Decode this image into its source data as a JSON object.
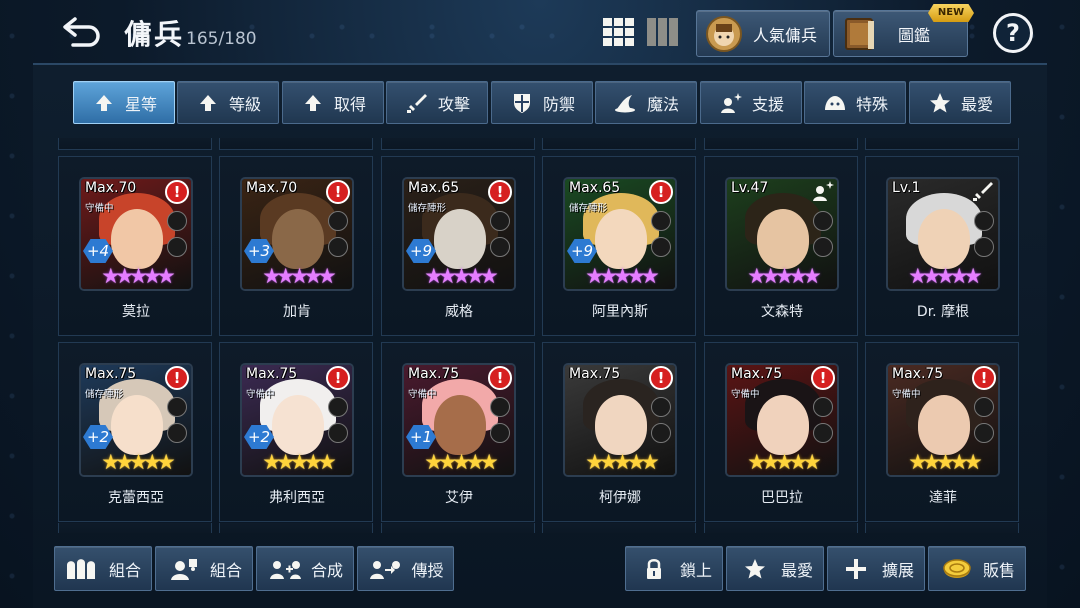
{
  "header": {
    "title": "傭兵",
    "count": "165/180",
    "popular_label": "人氣傭兵",
    "codex_label": "圖鑑",
    "new_badge": "NEW",
    "help_label": "?"
  },
  "filters": [
    {
      "label": "星等",
      "icon": "arrow-up-icon",
      "active": true
    },
    {
      "label": "等級",
      "icon": "arrow-up-icon",
      "active": false
    },
    {
      "label": "取得",
      "icon": "arrow-up-icon",
      "active": false
    },
    {
      "label": "攻擊",
      "icon": "sword-icon",
      "active": false
    },
    {
      "label": "防禦",
      "icon": "shield-icon",
      "active": false
    },
    {
      "label": "魔法",
      "icon": "wizard-hat-icon",
      "active": false
    },
    {
      "label": "支援",
      "icon": "sparkle-person-icon",
      "active": false
    },
    {
      "label": "特殊",
      "icon": "slime-icon",
      "active": false
    },
    {
      "label": "最愛",
      "icon": "star-icon",
      "active": false
    }
  ],
  "mercenaries": [
    {
      "name": "莫拉",
      "level": "Max.70",
      "status": "守備中",
      "plus": "+4",
      "star_color": "purple",
      "alert": true,
      "bg": "#6e1a1a",
      "hair": "#c8442a",
      "skin": "#f1c7a6"
    },
    {
      "name": "加肯",
      "level": "Max.70",
      "status": "",
      "plus": "+3",
      "star_color": "purple",
      "alert": true,
      "bg": "#3a2414",
      "hair": "#5a3a22",
      "skin": "#8a6848"
    },
    {
      "name": "威格",
      "level": "Max.65",
      "status": "儲存陣形",
      "plus": "+9",
      "star_color": "purple",
      "alert": true,
      "bg": "#2a2018",
      "hair": "#3b2a1c",
      "skin": "#d8d2c8"
    },
    {
      "name": "阿里內斯",
      "level": "Max.65",
      "status": "儲存陣形",
      "plus": "+9",
      "star_color": "purple",
      "alert": true,
      "bg": "#1a4a22",
      "hair": "#e0b85a",
      "skin": "#f3d8bd"
    },
    {
      "name": "文森特",
      "level": "Lv.47",
      "status": "",
      "plus": "",
      "star_color": "purple",
      "alert": false,
      "bg": "#1d3f1d",
      "hair": "#2c2418",
      "skin": "#e6c4a2"
    },
    {
      "name": "Dr. 摩根",
      "level": "Lv.1",
      "status": "",
      "plus": "",
      "star_color": "purple",
      "alert": false,
      "bg": "#2a2a2a",
      "hair": "#d8d8d8",
      "skin": "#efd2b6"
    },
    {
      "name": "克蕾西亞",
      "level": "Max.75",
      "status": "儲存陣形",
      "plus": "+2",
      "star_color": "gold",
      "alert": true,
      "bg": "#1e3a5a",
      "hair": "#d6c8b8",
      "skin": "#f6dfcb"
    },
    {
      "name": "弗利西亞",
      "level": "Max.75",
      "status": "守備中",
      "plus": "+2",
      "star_color": "gold",
      "alert": true,
      "bg": "#3b2a52",
      "hair": "#f1efee",
      "skin": "#f6e2d2"
    },
    {
      "name": "艾伊",
      "level": "Max.75",
      "status": "守備中",
      "plus": "+1",
      "star_color": "gold",
      "alert": true,
      "bg": "#4a1a2e",
      "hair": "#f2a9a9",
      "skin": "#a66d4a"
    },
    {
      "name": "柯伊娜",
      "level": "Max.75",
      "status": "",
      "plus": "",
      "star_color": "gold",
      "alert": true,
      "bg": "#3a3a3a",
      "hair": "#2a2420",
      "skin": "#f0d6c0"
    },
    {
      "name": "巴巴拉",
      "level": "Max.75",
      "status": "守備中",
      "plus": "",
      "star_color": "gold",
      "alert": true,
      "bg": "#5a1414",
      "hair": "#1a1416",
      "skin": "#f0d2bc"
    },
    {
      "name": "達菲",
      "level": "Max.75",
      "status": "守備中",
      "plus": "",
      "star_color": "gold",
      "alert": true,
      "bg": "#4a2a22",
      "hair": "#2e221c",
      "skin": "#eccab0"
    }
  ],
  "stars_text": "★★★★★",
  "alert_symbol": "!",
  "bottom_left": [
    {
      "label": "組合",
      "icon": "group-icon"
    },
    {
      "label": "組合",
      "icon": "puzzle-person-icon"
    },
    {
      "label": "合成",
      "icon": "merge-icon"
    },
    {
      "label": "傳授",
      "icon": "transfer-icon"
    }
  ],
  "bottom_right": [
    {
      "label": "鎖上",
      "icon": "lock-icon"
    },
    {
      "label": "最愛",
      "icon": "star-icon"
    },
    {
      "label": "擴展",
      "icon": "plus-icon"
    },
    {
      "label": "販售",
      "icon": "coin-icon"
    }
  ]
}
